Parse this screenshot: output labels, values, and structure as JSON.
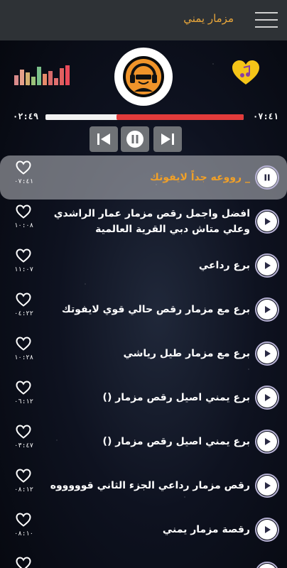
{
  "header": {
    "title": "مزمار يمني",
    "menu_icon": "hamburger-menu-icon",
    "background": "#2e3236",
    "title_color": "#e8a63a"
  },
  "player": {
    "elapsed": "٠٢:٤٩",
    "total": "٠٧:٤١",
    "progress": 0.64,
    "progress_color": "#e23b3b",
    "logo_icon": "dj-headphones-logo-icon",
    "favorite_icon": "heart-music-note-icon",
    "equalizer_icon": "equalizer-bars-icon",
    "controls": {
      "prev_icon": "skip-previous-icon",
      "pause_icon": "pause-icon",
      "next_icon": "skip-next-icon"
    }
  },
  "tracks": [
    {
      "title": "_ رووعه جداً لايفوتك",
      "duration": "٠٧:٤١",
      "active": true
    },
    {
      "title": "افضل واجمل رقص مزمار عمار الراشدي وعلي متاش دبي القرية العالمية",
      "duration": "١٠:٠٨",
      "active": false
    },
    {
      "title": "برع رداعي",
      "duration": "١١:٠٧",
      "active": false
    },
    {
      "title": "برع مع مزمار رقص حالي قوي لايفوتك",
      "duration": "٠٤:٢٢",
      "active": false
    },
    {
      "title": "برع مع مزمار طيل رياشي",
      "duration": "١٠:٢٨",
      "active": false
    },
    {
      "title": "برع يمني اصيل رقص  مزمار  ()",
      "duration": "٠٦:١٢",
      "active": false
    },
    {
      "title": "برع يمني اصيل رقص  مزمار  ()",
      "duration": "٠٣:٤٧",
      "active": false
    },
    {
      "title": "رقص مزمار رداعي الجزء الثاني قوووووه",
      "duration": "٠٨:١٢",
      "active": false
    },
    {
      "title": "رقصة مزمار يمني",
      "duration": "٠٨:١٠",
      "active": false
    },
    {
      "title": "",
      "duration": "",
      "active": false
    }
  ]
}
